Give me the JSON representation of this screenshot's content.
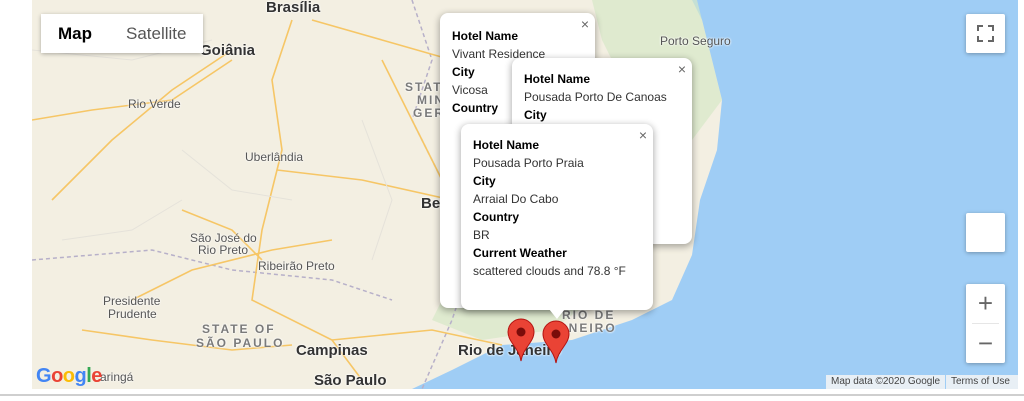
{
  "map_type": {
    "map": "Map",
    "satellite": "Satellite"
  },
  "places": {
    "brasilia": "Brasília",
    "goiania": "Goiânia",
    "porto_seguro": "Porto Seguro",
    "rio_verde": "Rio Verde",
    "uberlandia": "Uberlândia",
    "sao_jose_rio_preto_1": "São José do",
    "sao_jose_rio_preto_2": "Rio Preto",
    "ribeirao_preto": "Ribeirão Preto",
    "presidente_prudente_1": "Presidente",
    "presidente_prudente_2": "Prudente",
    "state_sp_1": "STATE OF",
    "state_sp_2": "SÃO PAULO",
    "campinas": "Campinas",
    "sao_paulo": "São Paulo",
    "rio_de_janeiro": "Rio de Janeiro",
    "belo": "Belo",
    "marinega": "aringá",
    "state_mg_1": "STAT",
    "state_mg_2": "MIN",
    "state_mg_3": "GER",
    "rio_de_janeiro_state_1": "RIO DE",
    "rio_de_janeiro_state_2": "ANEIRO"
  },
  "popups": [
    {
      "hotel_label": "Hotel Name",
      "hotel": "Vivant Residence",
      "city_label": "City",
      "city": "Vicosa",
      "country_label": "Country"
    },
    {
      "hotel_label": "Hotel Name",
      "hotel": "Pousada Porto De Canoas",
      "city_label": "City"
    },
    {
      "hotel_label": "Hotel Name",
      "hotel": "Pousada Porto Praia",
      "city_label": "City",
      "city": "Arraial Do Cabo",
      "country_label": "Country",
      "country": "BR",
      "weather_label": "Current Weather",
      "weather": "scattered clouds and 78.8 °F"
    }
  ],
  "close_glyph": "×",
  "zoom": {
    "in": "+",
    "out": "−"
  },
  "attribution": {
    "map_data": "Map data ©2020 Google",
    "terms": "Terms of Use"
  },
  "logo": "Google",
  "colors": {
    "land": "#f3efe2",
    "water": "#9fcdf5",
    "marker": "#ea4335",
    "roads": "#f6c666"
  }
}
